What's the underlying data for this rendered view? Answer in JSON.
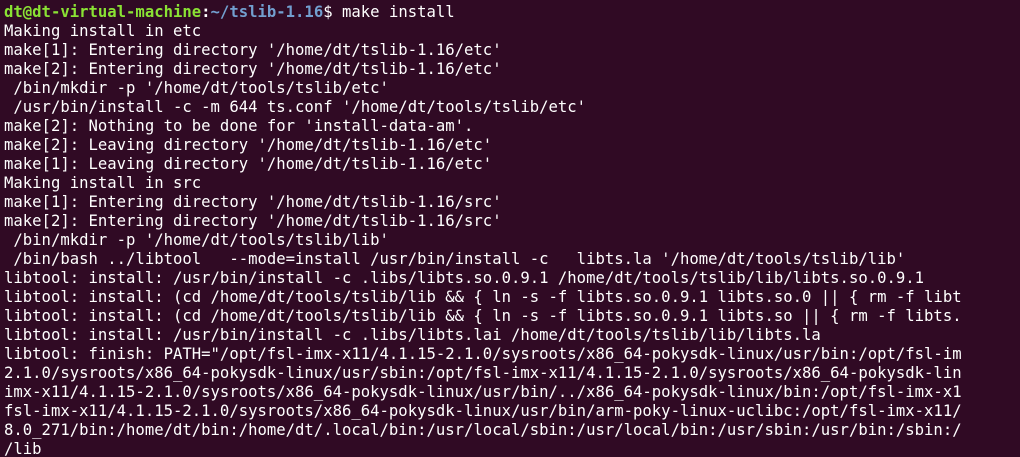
{
  "prompt": {
    "user_host": "dt@dt-virtual-machine",
    "colon": ":",
    "path": "~/tslib-1.16",
    "symbol": "$ ",
    "command": "make install",
    "colors": {
      "user_host": "#8ae234",
      "path": "#729fcf",
      "background": "#300a24",
      "text": "#ffffff"
    }
  },
  "output_lines": [
    "Making install in etc",
    "make[1]: Entering directory '/home/dt/tslib-1.16/etc'",
    "make[2]: Entering directory '/home/dt/tslib-1.16/etc'",
    " /bin/mkdir -p '/home/dt/tools/tslib/etc'",
    " /usr/bin/install -c -m 644 ts.conf '/home/dt/tools/tslib/etc'",
    "make[2]: Nothing to be done for 'install-data-am'.",
    "make[2]: Leaving directory '/home/dt/tslib-1.16/etc'",
    "make[1]: Leaving directory '/home/dt/tslib-1.16/etc'",
    "Making install in src",
    "make[1]: Entering directory '/home/dt/tslib-1.16/src'",
    "make[2]: Entering directory '/home/dt/tslib-1.16/src'",
    " /bin/mkdir -p '/home/dt/tools/tslib/lib'",
    " /bin/bash ../libtool   --mode=install /usr/bin/install -c   libts.la '/home/dt/tools/tslib/lib'",
    "libtool: install: /usr/bin/install -c .libs/libts.so.0.9.1 /home/dt/tools/tslib/lib/libts.so.0.9.1",
    "libtool: install: (cd /home/dt/tools/tslib/lib && { ln -s -f libts.so.0.9.1 libts.so.0 || { rm -f libt",
    "libtool: install: (cd /home/dt/tools/tslib/lib && { ln -s -f libts.so.0.9.1 libts.so || { rm -f libts.",
    "libtool: install: /usr/bin/install -c .libs/libts.lai /home/dt/tools/tslib/lib/libts.la",
    "libtool: finish: PATH=\"/opt/fsl-imx-x11/4.1.15-2.1.0/sysroots/x86_64-pokysdk-linux/usr/bin:/opt/fsl-im",
    "2.1.0/sysroots/x86_64-pokysdk-linux/usr/sbin:/opt/fsl-imx-x11/4.1.15-2.1.0/sysroots/x86_64-pokysdk-lin",
    "imx-x11/4.1.15-2.1.0/sysroots/x86_64-pokysdk-linux/usr/bin/../x86_64-pokysdk-linux/bin:/opt/fsl-imx-x1",
    "fsl-imx-x11/4.1.15-2.1.0/sysroots/x86_64-pokysdk-linux/usr/bin/arm-poky-linux-uclibc:/opt/fsl-imx-x11/",
    "8.0_271/bin:/home/dt/bin:/home/dt/.local/bin:/usr/local/sbin:/usr/local/bin:/usr/sbin:/usr/bin:/sbin:/",
    "/lib"
  ]
}
